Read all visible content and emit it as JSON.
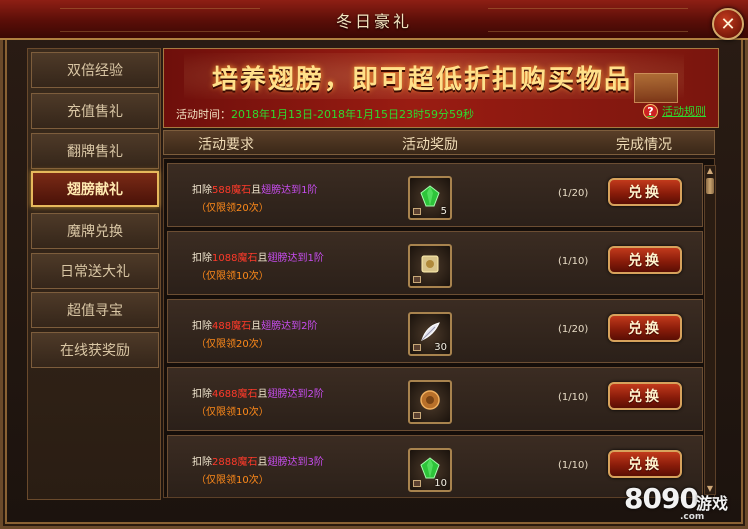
{
  "window": {
    "title": "冬日豪礼",
    "close_symbol": "✕"
  },
  "sidebar": {
    "items": [
      {
        "label": "双倍经验",
        "active": false
      },
      {
        "label": "充值售礼",
        "active": false
      },
      {
        "label": "翻牌售礼",
        "active": false
      },
      {
        "label": "翅膀献礼",
        "active": true
      },
      {
        "label": "魔牌兑换",
        "active": false
      },
      {
        "label": "日常送大礼",
        "active": false
      },
      {
        "label": "超值寻宝",
        "active": false
      },
      {
        "label": "在线获奖励",
        "active": false
      }
    ]
  },
  "banner": {
    "title": "培养翅膀，即可超低折扣购买物品",
    "time_label": "活动时间：",
    "time_value": "2018年1月13日-2018年1月15日23时59分59秒",
    "help_symbol": "?",
    "rules_label": "活动规则"
  },
  "table": {
    "headers": {
      "requirement": "活动要求",
      "reward": "活动奖励",
      "status": "完成情况"
    },
    "button_label": "兑换",
    "rows": [
      {
        "deduct": "扣除",
        "cost": "588魔石",
        "and": "且",
        "cond": "翅膀达到1阶",
        "limit": "（仅限领20次）",
        "count": "5",
        "progress": "(1/20)",
        "icon": "green-gem-icon",
        "color": "#2ec43a"
      },
      {
        "deduct": "扣除",
        "cost": "1088魔石",
        "and": "且",
        "cond": "翅膀达到1阶",
        "limit": "（仅限领10次）",
        "count": "",
        "progress": "(1/10)",
        "icon": "scroll-icon",
        "color": "#d8c48a"
      },
      {
        "deduct": "扣除",
        "cost": "488魔石",
        "and": "且",
        "cond": "翅膀达到2阶",
        "limit": "（仅限领20次）",
        "count": "30",
        "progress": "(1/20)",
        "icon": "feather-icon",
        "color": "#e6e6f0"
      },
      {
        "deduct": "扣除",
        "cost": "4688魔石",
        "and": "且",
        "cond": "翅膀达到2阶",
        "limit": "（仅限领10次）",
        "count": "",
        "progress": "(1/10)",
        "icon": "coin-icon",
        "color": "#b8702a"
      },
      {
        "deduct": "扣除",
        "cost": "2888魔石",
        "and": "且",
        "cond": "翅膀达到3阶",
        "limit": "（仅限领10次）",
        "count": "10",
        "progress": "(1/10)",
        "icon": "green-gem-icon",
        "color": "#2ec43a"
      }
    ]
  },
  "watermark": {
    "number": "8090",
    "game": "游戏",
    "domain": ".com"
  }
}
